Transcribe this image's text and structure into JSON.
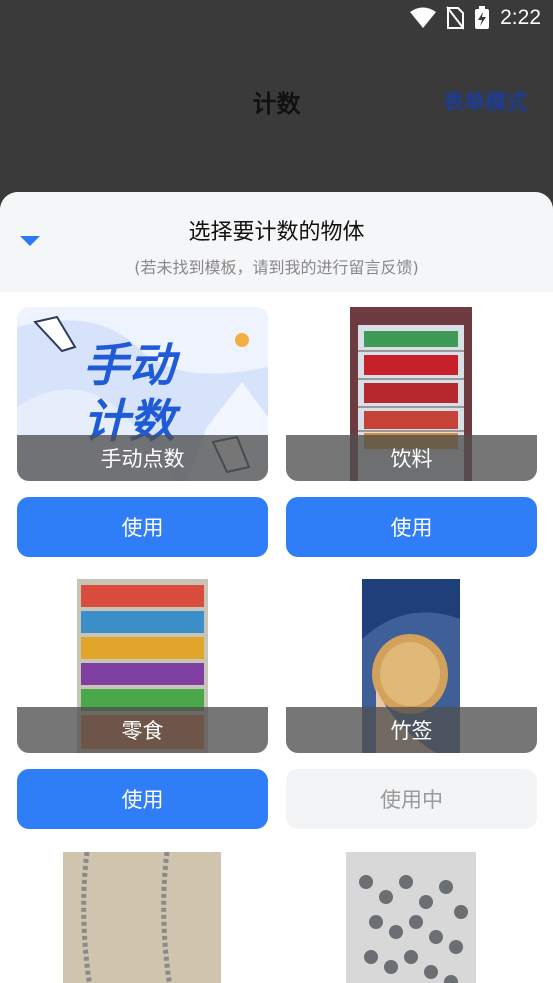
{
  "status": {
    "time": "2:22"
  },
  "appbar": {
    "title": "计数",
    "form_mode": "表单模式"
  },
  "sheet": {
    "title": "选择要计数的物体",
    "subtitle": "(若未找到模板，请到我的进行留言反馈)"
  },
  "items": [
    {
      "label": "手动点数",
      "button": "使用",
      "thumb_text_1": "手动",
      "thumb_text_2": "计数"
    },
    {
      "label": "饮料",
      "button": "使用"
    },
    {
      "label": "零食",
      "button": "使用"
    },
    {
      "label": "竹签",
      "button": "使用中"
    },
    {
      "label": "",
      "button": ""
    },
    {
      "label": "",
      "button": ""
    }
  ],
  "colors": {
    "accent": "#2f7ef7",
    "form_mode": "#1d3d93"
  }
}
